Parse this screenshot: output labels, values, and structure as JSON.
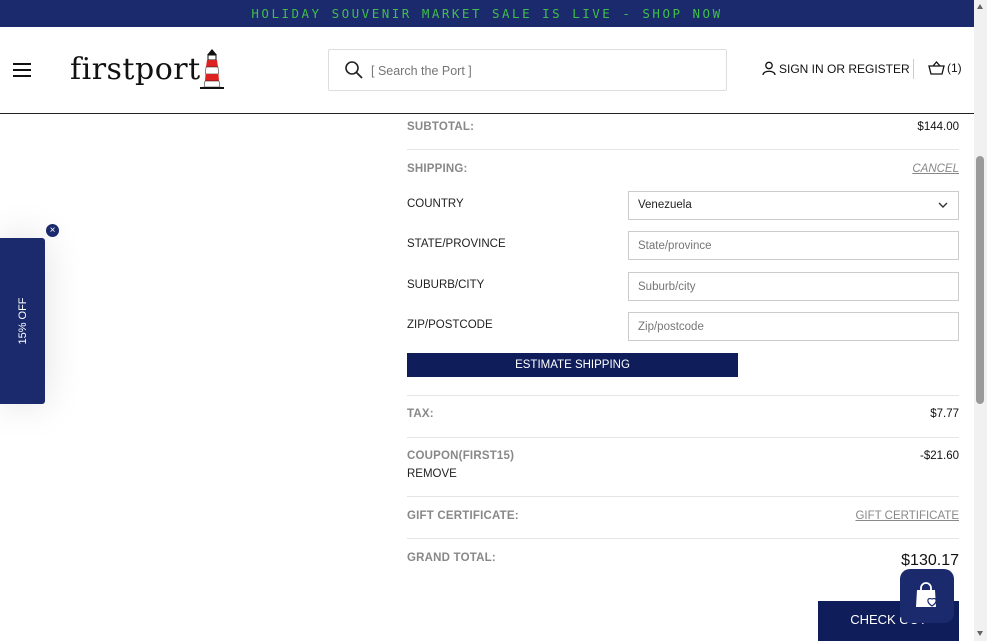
{
  "promo_bar": {
    "text": "HOLIDAY SOUVENIR MARKET SALE IS LIVE - SHOP NOW",
    "bg": "#1a2a6c",
    "fg": "#3fbf4a"
  },
  "header": {
    "logo_text": "firstport",
    "search_placeholder": "[ Search the Port ]",
    "signin_label": "SIGN IN OR REGISTER",
    "cart_count": "(1)"
  },
  "discount_tab": {
    "label": "15% OFF",
    "close": "×"
  },
  "summary": {
    "subtotal_label": "SUBTOTAL:",
    "subtotal_value": "$144.00",
    "shipping_label": "SHIPPING:",
    "cancel_link": "CANCEL",
    "country_label": "COUNTRY",
    "country_value": "Venezuela",
    "state_label": "STATE/PROVINCE",
    "state_placeholder": "State/province",
    "city_label": "SUBURB/CITY",
    "city_placeholder": "Suburb/city",
    "zip_label": "ZIP/POSTCODE",
    "zip_placeholder": "Zip/postcode",
    "estimate_button": "ESTIMATE SHIPPING",
    "tax_label": "TAX:",
    "tax_value": "$7.77",
    "coupon_label": "COUPON(FIRST15)",
    "coupon_value": "-$21.60",
    "remove_link": "REMOVE",
    "gift_label": "GIFT CERTIFICATE:",
    "gift_link": "GIFT CERTIFICATE",
    "grand_label": "GRAND TOTAL:",
    "grand_value": "$130.17",
    "checkout_button": "CHECK OUT"
  },
  "colors": {
    "navy": "#0f1e5a",
    "accent_green": "#3fbf4a"
  }
}
